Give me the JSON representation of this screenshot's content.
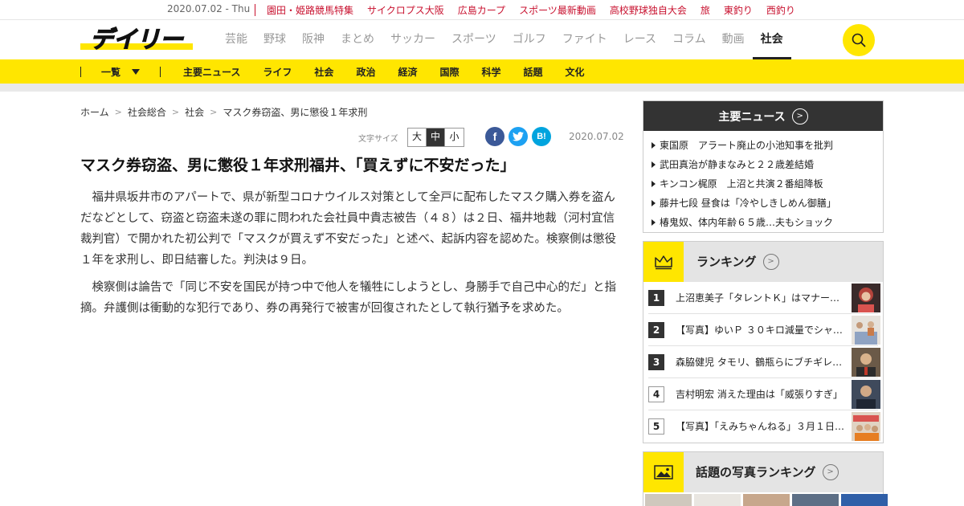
{
  "topbar": {
    "date": "2020.07.02 - Thu",
    "links": [
      "園田・姫路競馬特集",
      "サイクロプス大阪",
      "広島カープ",
      "スポーツ最新動画",
      "高校野球独自大会",
      "旅",
      "東釣り",
      "西釣り"
    ]
  },
  "header": {
    "logo_text": "デイリー",
    "nav": [
      "芸能",
      "野球",
      "阪神",
      "まとめ",
      "サッカー",
      "スポーツ",
      "ゴルフ",
      "ファイト",
      "レース",
      "コラム",
      "動画",
      "社会"
    ],
    "active_nav": "社会"
  },
  "subnav": {
    "ichiran": "一覧",
    "links": [
      "主要ニュース",
      "ライフ",
      "社会",
      "政治",
      "経済",
      "国際",
      "科学",
      "話題",
      "文化"
    ]
  },
  "breadcrumb": [
    "ホーム",
    "社会総合",
    "社会",
    "マスク券窃盗、男に懲役１年求刑"
  ],
  "tools": {
    "fontsize_label": "文字サイズ",
    "sizes": [
      "大",
      "中",
      "小"
    ],
    "selected_size": "中",
    "date": "2020.07.02"
  },
  "article": {
    "title": "マスク券窃盗、男に懲役１年求刑福井、「買えずに不安だった」",
    "paragraphs": [
      "福井県坂井市のアパートで、県が新型コロナウイルス対策として全戸に配布したマスク購入券を盗んだなどとして、窃盗と窃盗未遂の罪に問われた会社員中貴志被告（４８）は２日、福井地裁（河村宜信裁判官）で開かれた初公判で「マスクが買えず不安だった」と述べ、起訴内容を認めた。検察側は懲役１年を求刑し、即日結審した。判決は９日。",
      "検察側は論告で「同じ不安を国民が持つ中で他人を犠牲にしようとし、身勝手で自己中心的だ」と指摘。弁護側は衝動的な犯行であり、券の再発行で被害が回復されたとして執行猶予を求めた。"
    ]
  },
  "sidebar": {
    "main_news_title": "主要ニュース",
    "main_news": [
      "東国原　アラート廃止の小池知事を批判",
      "武田真治が静まなみと２２歳差結婚",
      "キンコン梶原　上沼と共演２番組降板",
      "藤井七段 昼食は「冷やしきしめん御膳」",
      "椿鬼奴、体内年齢６５歳…夫もショック"
    ],
    "ranking_title": "ランキング",
    "ranking": [
      {
        "num": "1",
        "text": "上沼恵美子「タレントＫ」はマナー…"
      },
      {
        "num": "2",
        "text": "【写真】ゆいＰ ３０キロ減量でシャ…"
      },
      {
        "num": "3",
        "text": "森脇健児 タモリ、鶴瓶らにブチギレ…"
      },
      {
        "num": "4",
        "text": "吉村明宏 消えた理由は「威張りすぎ」"
      },
      {
        "num": "5",
        "text": "【写真】「えみちゃんねる」３月１日…"
      }
    ],
    "photo_ranking_title": "話題の写真ランキング"
  },
  "colors": {
    "brand_yellow": "#ffe600",
    "top_link_red": "#c8102e",
    "dark_header": "#333333"
  }
}
